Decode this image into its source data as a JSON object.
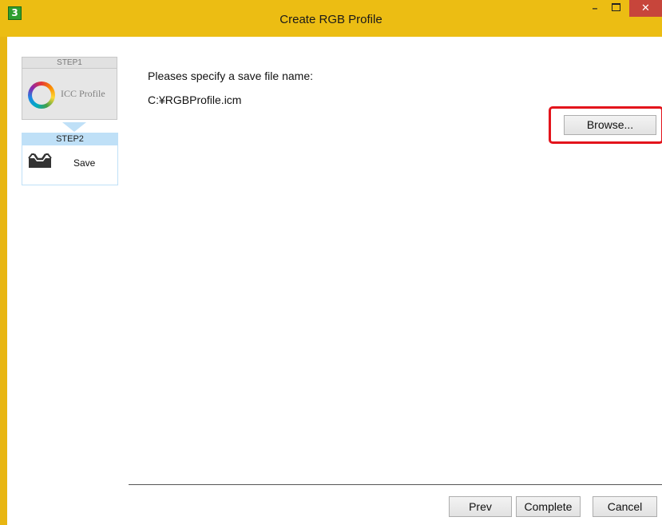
{
  "window": {
    "title": "Create RGB Profile",
    "app_icon_glyph": "3",
    "minimize_glyph": "–",
    "close_glyph": "✕"
  },
  "steps": [
    {
      "header": "STEP1",
      "label": "ICC Profile",
      "icon": "color-ring-icon",
      "state": "done"
    },
    {
      "header": "STEP2",
      "label": "Save",
      "icon": "save-tray-icon",
      "state": "active"
    }
  ],
  "main": {
    "prompt": "Pleases specify a save file name:",
    "file_path": "C:¥RGBProfile.icm",
    "browse_label": "Browse..."
  },
  "footer": {
    "prev_label": "Prev",
    "complete_label": "Complete",
    "cancel_label": "Cancel"
  },
  "colors": {
    "title_bar": "#ecbd13",
    "close_button": "#c7453b",
    "active_step": "#bfe0f7",
    "highlight": "#e3141c"
  }
}
